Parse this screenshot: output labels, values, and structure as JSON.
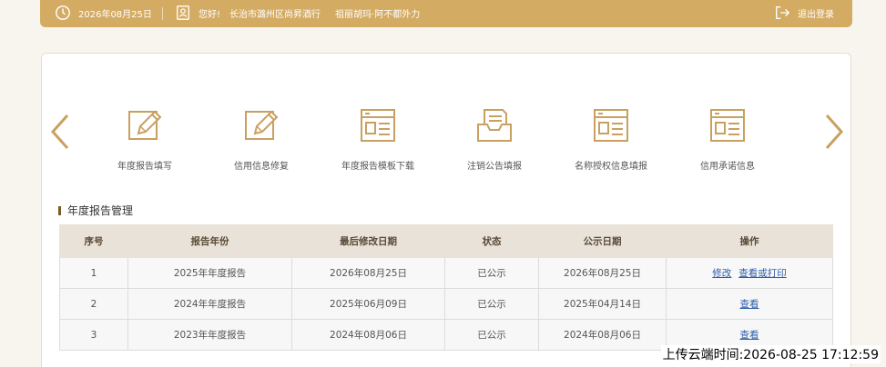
{
  "topbar": {
    "date": "2026年08月25日",
    "greeting": "您好!",
    "company": "长治市潞州区尚昇酒行",
    "slogan": "祖丽胡玛·阿不都外力",
    "logout": "退出登录",
    "icons": [
      "clock-icon",
      "user-card-icon",
      "logout-icon"
    ]
  },
  "menu": {
    "items": [
      {
        "label": "年度报告填写",
        "icon": "edit-icon"
      },
      {
        "label": "信用信息修复",
        "icon": "edit-icon"
      },
      {
        "label": "年度报告模板下载",
        "icon": "template-icon"
      },
      {
        "label": "注销公告填报",
        "icon": "inbox-document-icon"
      },
      {
        "label": "名称授权信息填报",
        "icon": "template-icon"
      },
      {
        "label": "信用承诺信息",
        "icon": "template-icon"
      }
    ]
  },
  "section": {
    "title": "年度报告管理"
  },
  "table": {
    "headers": [
      "序号",
      "报告年份",
      "最后修改日期",
      "状态",
      "公示日期",
      "操作"
    ],
    "rows": [
      {
        "no": "1",
        "year": "2025年年度报告",
        "modified": "2026年08月25日",
        "status": "已公示",
        "pub": "2026年08月25日",
        "actions": [
          "修改",
          "查看或打印"
        ]
      },
      {
        "no": "2",
        "year": "2024年年度报告",
        "modified": "2025年06月09日",
        "status": "已公示",
        "pub": "2025年04月14日",
        "actions": [
          "查看"
        ]
      },
      {
        "no": "3",
        "year": "2023年年度报告",
        "modified": "2024年08月06日",
        "status": "已公示",
        "pub": "2024年08月06日",
        "actions": [
          "查看"
        ]
      }
    ]
  },
  "footer": {
    "upload_time": "上传云端时间:2026-08-25 17:12:59"
  },
  "colors": {
    "accent": "#d4ab63",
    "icon": "#c9a060",
    "link": "#2d5ca8",
    "header_bg": "#e9e2d8"
  }
}
